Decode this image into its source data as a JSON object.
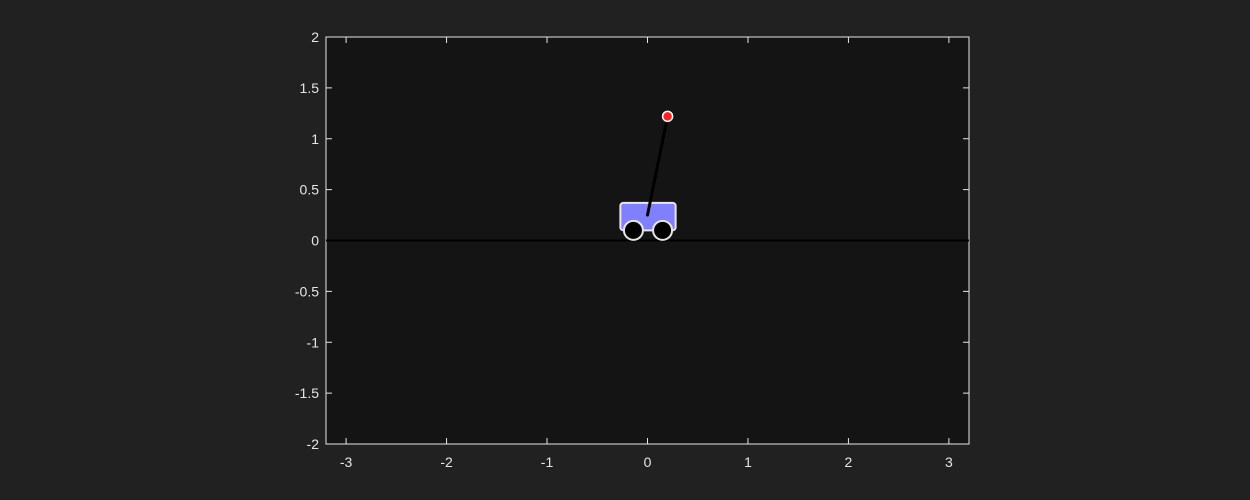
{
  "chart_data": {
    "type": "scatter",
    "title": "",
    "xlabel": "",
    "ylabel": "",
    "xlim": [
      -3.2,
      3.2
    ],
    "ylim": [
      -2,
      2
    ],
    "x_ticks": [
      -3,
      -2,
      -1,
      0,
      1,
      2,
      3
    ],
    "y_ticks": [
      2,
      1.5,
      1,
      0.5,
      0,
      -0.5,
      -1,
      -1.5,
      -2
    ],
    "x_tick_labels": [
      "-3",
      "-2",
      "-1",
      "0",
      "1",
      "2",
      "3"
    ],
    "y_tick_labels": [
      "2",
      "1.5",
      "1",
      "0.5",
      "0",
      "-0.5",
      "-1",
      "-1.5",
      "-2"
    ],
    "grid": false,
    "ground_line": {
      "y": 0,
      "x_range": [
        -3.2,
        3.2
      ],
      "color": "#000000"
    },
    "cart": {
      "x_range": [
        -0.27,
        0.28
      ],
      "y_range": [
        0.1,
        0.37
      ],
      "fill_color": "#8080ff",
      "edge_color": "#e6e6e6"
    },
    "wheels": [
      {
        "x": -0.14,
        "y": 0.1
      },
      {
        "x": 0.15,
        "y": 0.1
      }
    ],
    "pole": {
      "x_start": 0.0,
      "y_start": 0.25,
      "x_end": 0.2,
      "y_end": 1.22,
      "color": "#000000"
    },
    "pole_tip": {
      "x": 0.2,
      "y": 1.22,
      "color": "#ff2020"
    }
  },
  "colors": {
    "figure_background": "#212121",
    "axes_background": "#141414",
    "axis_color": "#e6e6e6"
  }
}
